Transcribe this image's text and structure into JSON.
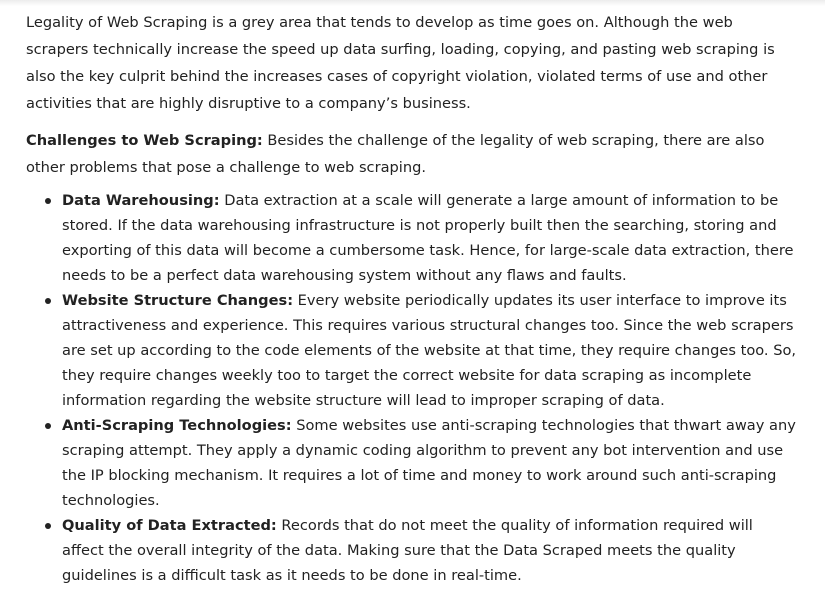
{
  "intro": "Legality of Web Scraping is a grey area that tends to develop as time goes on. Although the web scrapers technically increase the speed up data surfing, loading, copying, and pasting web scraping is also the key culprit behind the increases cases of copyright violation, violated terms of use and other activities that are highly disruptive to a company’s business.",
  "challenges": {
    "heading": "Challenges to Web Scraping:",
    "text": " Besides the challenge of the legality of web scraping, there are also other problems that pose a challenge to web scraping."
  },
  "items": [
    {
      "title": "Data Warehousing:",
      "text": " Data extraction at a scale will generate a large amount of information to be stored. If the data warehousing infrastructure is not properly built then the searching, storing and exporting of this data will become a cumbersome task. Hence, for large-scale data extraction, there needs to be a perfect data warehousing system without any flaws and faults."
    },
    {
      "title": "Website Structure Changes:",
      "text": " Every website periodically updates its user interface to improve its attractiveness and experience. This requires various structural changes too. Since the web scrapers are set up according to the code elements of the website at that time, they require changes too. So, they require changes weekly too to target the correct website for data scraping as incomplete information regarding the website structure will lead to improper scraping of data."
    },
    {
      "title": "Anti-Scraping Technologies:",
      "text": " Some websites use anti-scraping technologies that thwart away any scraping attempt. They apply a dynamic coding algorithm to prevent any bot intervention and use the IP blocking mechanism. It requires a lot of time and money to work around such anti-scraping technologies."
    },
    {
      "title": "Quality of Data Extracted:",
      "text": " Records that do not meet the quality of information required will affect the overall integrity of the data. Making sure that the Data Scraped meets the quality guidelines is a difficult task as it needs to be done in real-time."
    }
  ]
}
